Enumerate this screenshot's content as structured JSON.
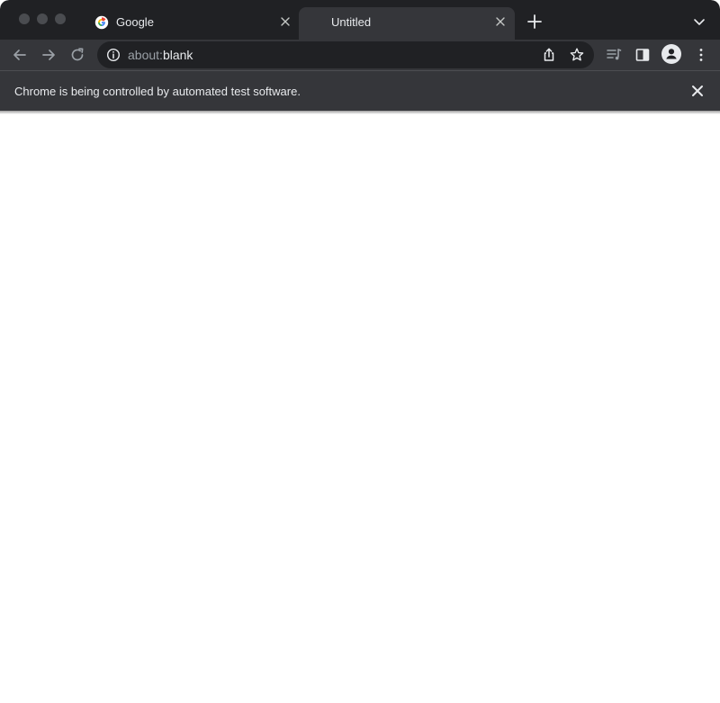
{
  "tabs": [
    {
      "title": "Google",
      "icon": "google-favicon-icon",
      "active": false
    },
    {
      "title": "Untitled",
      "icon": "",
      "active": true
    }
  ],
  "toolbar": {
    "url_scheme": "about:",
    "url_host": "blank"
  },
  "infobar": {
    "message": "Chrome is being controlled by automated test software."
  },
  "colors": {
    "tabstrip_bg": "#202124",
    "toolbar_bg": "#35363a",
    "omnibox_bg": "#202124",
    "text_primary": "#e8eaed",
    "text_secondary": "#9aa0a6"
  }
}
